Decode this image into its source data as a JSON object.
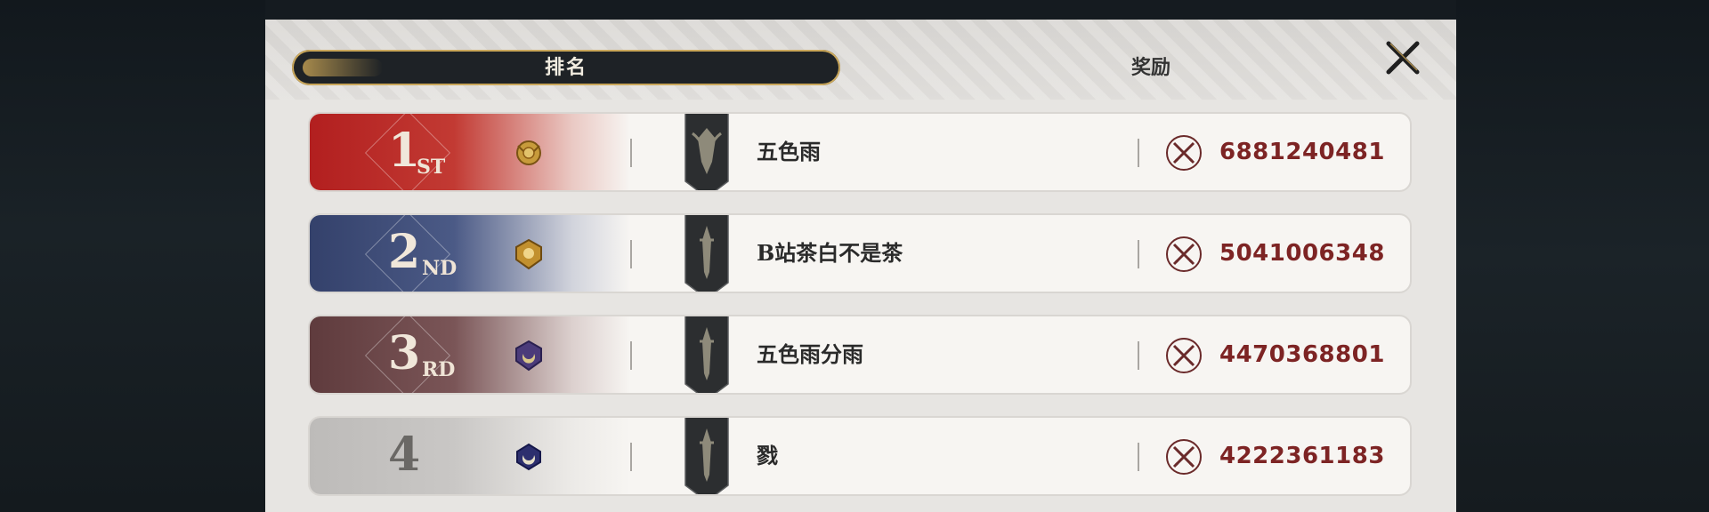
{
  "tabs": {
    "rank_label": "排名",
    "reward_label": "奖励"
  },
  "icons": {
    "close": "close-icon",
    "power": "crossed-swords-icon",
    "banner": "guild-banner-icon",
    "badge": "rank-badge-icon"
  },
  "colors": {
    "rank1": "#b21f1f",
    "rank2": "#34416b",
    "rank3": "#5f3b3d",
    "rank4": "#bdbbb9",
    "power_text": "#7d2424",
    "active_tab": "#1e2226",
    "tab_accent": "#caa75a"
  },
  "rows": [
    {
      "rank": "1",
      "suffix": "ST",
      "name": "五色雨",
      "power": "6881240481"
    },
    {
      "rank": "2",
      "suffix": "ND",
      "name": "B站茶白不是茶",
      "power": "5041006348"
    },
    {
      "rank": "3",
      "suffix": "RD",
      "name": "五色雨分雨",
      "power": "4470368801"
    },
    {
      "rank": "4",
      "suffix": "",
      "name": "戮",
      "power": "4222361183"
    }
  ]
}
